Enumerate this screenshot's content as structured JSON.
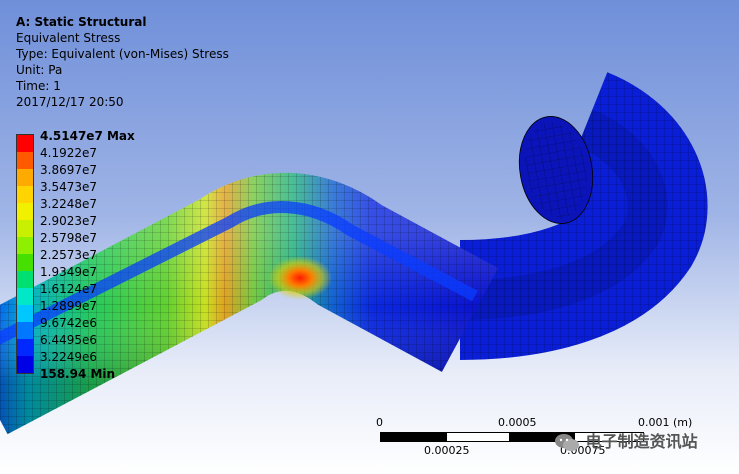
{
  "info": {
    "title": "A: Static Structural",
    "result": "Equivalent Stress",
    "type": "Type: Equivalent (von-Mises) Stress",
    "unit": "Unit: Pa",
    "time": "Time: 1",
    "date": "2017/12/17 20:50"
  },
  "legend": {
    "max_label": "4.5147e7 Max",
    "min_label": "158.94 Min",
    "levels": [
      "4.1922e7",
      "3.8697e7",
      "3.5473e7",
      "3.2248e7",
      "2.9023e7",
      "2.5798e7",
      "2.2573e7",
      "1.9349e7",
      "1.6124e7",
      "1.2899e7",
      "9.6742e6",
      "6.4495e6",
      "3.2249e6"
    ],
    "colors": [
      "#ff0000",
      "#ff5a00",
      "#ffaa00",
      "#ffd400",
      "#f0f000",
      "#c8f000",
      "#8ef000",
      "#46e000",
      "#00e070",
      "#00e8c8",
      "#00c8ff",
      "#0078ff",
      "#0028ff",
      "#0000e6"
    ]
  },
  "scale": {
    "top_labels": [
      "0",
      "0.0005",
      "0.001 (m)"
    ],
    "bottom_labels": [
      "0.00025",
      "0.00075"
    ]
  },
  "watermark": {
    "text": "电子制造资讯站",
    "icon": "wechat-icon"
  }
}
